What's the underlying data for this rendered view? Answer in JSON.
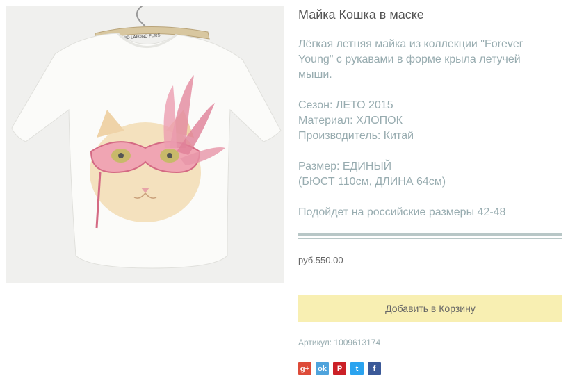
{
  "product": {
    "title": "Майка Кошка в маске",
    "description": "Лёгкая летняя майка из коллекции \"Forever Young\" с рукавами в форме крыла летучей мыши.",
    "season": "Сезон: ЛЕТО 2015",
    "material": "Материал: ХЛОПОК",
    "manufacturer": "Производитель: Китай",
    "size_line1": "Размер: ЕДИНЫЙ",
    "size_line2": "(БЮСТ 110см, ДЛИНА 64см)",
    "fits": "Подойдет на российские размеры 42-48",
    "price": "руб.550.00",
    "cart_button": "Добавить в Корзину",
    "sku": "Артикул: 1009613174"
  },
  "image": {
    "hanger_label": "BERNARD LAFOND FURS"
  },
  "social": [
    {
      "icon": "google-plus-icon",
      "glyph": "g+",
      "color": "#dd4b39"
    },
    {
      "icon": "odnoklassniki-icon",
      "glyph": "ok",
      "color": "#4fa3dc"
    },
    {
      "icon": "pinterest-icon",
      "glyph": "P",
      "color": "#cb2027"
    },
    {
      "icon": "twitter-icon",
      "glyph": "t",
      "color": "#2aa3ef"
    },
    {
      "icon": "facebook-icon",
      "glyph": "f",
      "color": "#3b5998"
    }
  ]
}
